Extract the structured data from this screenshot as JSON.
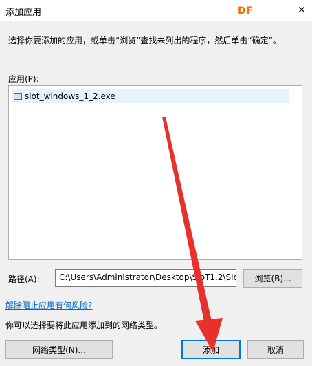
{
  "window": {
    "title": "添加应用",
    "logo_text": "DF",
    "close_glyph": "✕"
  },
  "instruction": "选择你要添加的应用，或单击“浏览”查找未列出的程序，然后单击“确定”。",
  "apps": {
    "label": "应用(P):",
    "items": [
      {
        "name": "siot_windows_1_2.exe",
        "icon": "exe-file-icon"
      }
    ]
  },
  "path": {
    "label": "路径(A):",
    "value": "C:\\Users\\Administrator\\Desktop\\SIoT1.2\\SIo",
    "browse_label": "浏览(B)..."
  },
  "risk_link": "解除阻止应用有何风险?",
  "network_text": "你可以选择要将此应用添加到的网络类型。",
  "buttons": {
    "network_types": "网络类型(N)...",
    "add": "添加",
    "cancel": "取消"
  },
  "colors": {
    "accent": "#0078d7",
    "link": "#0066cc",
    "annotation_arrow": "#e8302c"
  }
}
